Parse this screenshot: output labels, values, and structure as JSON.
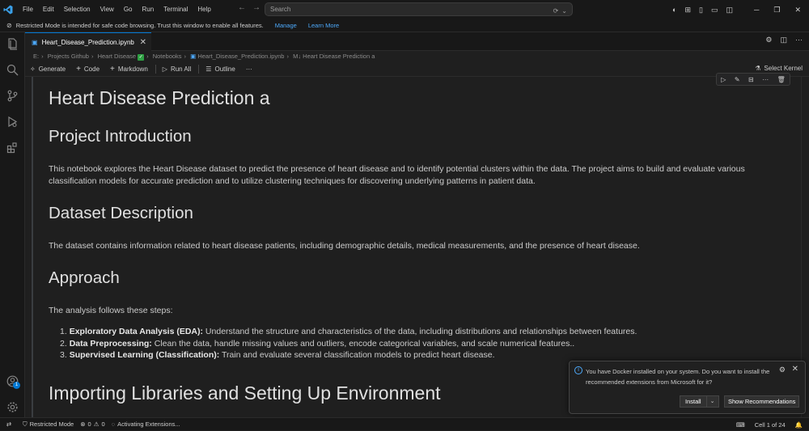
{
  "titlebar": {
    "menus": [
      "File",
      "Edit",
      "Selection",
      "View",
      "Go",
      "Run",
      "Terminal",
      "Help"
    ],
    "search_placeholder": "Search"
  },
  "restricted_banner": {
    "message": "Restricted Mode is intended for safe code browsing. Trust this window to enable all features.",
    "manage_label": "Manage",
    "learn_more_label": "Learn More"
  },
  "tab": {
    "filename": "Heart_Disease_Prediction.ipynb"
  },
  "breadcrumb": {
    "items": [
      "E:",
      "Projects Github",
      "Heart Disease",
      "Notebooks",
      "Heart_Disease_Prediction.ipynb",
      "Heart Disease Prediction a"
    ]
  },
  "toolbar": {
    "generate": "Generate",
    "code": "Code",
    "markdown": "Markdown",
    "run_all": "Run All",
    "outline": "Outline",
    "more": "···",
    "select_kernel": "Select Kernel"
  },
  "notebook": {
    "title": "Heart Disease Prediction a",
    "section1_heading": "Project Introduction",
    "section1_text": "This notebook explores the Heart Disease dataset to predict the presence of heart disease and to identify potential clusters within the data. The project aims to build and evaluate various classification models for accurate prediction and to utilize clustering techniques for discovering underlying patterns in patient data.",
    "section2_heading": "Dataset Description",
    "section2_text": "The dataset contains information related to heart disease patients, including demographic details, medical measurements, and the presence of heart disease.",
    "section3_heading": "Approach",
    "section3_intro": "The analysis follows these steps:",
    "steps": [
      {
        "num": "1.",
        "bold": "Exploratory Data Analysis (EDA):",
        "text": " Understand the structure and characteristics of the data, including distributions and relationships between features."
      },
      {
        "num": "2.",
        "bold": "Data Preprocessing:",
        "text": " Clean the data, handle missing values and outliers, encode categorical variables, and scale numerical features.."
      },
      {
        "num": "3.",
        "bold": "Supervised Learning (Classification):",
        "text": " Train and evaluate several classification models to predict heart disease."
      }
    ],
    "section4_heading": "Importing Libraries and Setting Up Environment"
  },
  "notification": {
    "message": "You have Docker installed on your system. Do you want to install the recommended extensions from Microsoft for it?",
    "install_label": "Install",
    "recommendations_label": "Show Recommendations"
  },
  "accounts_badge": "1",
  "statusbar": {
    "restricted": "Restricted Mode",
    "errors": "0",
    "warnings": "0",
    "activity": "Activating Extensions...",
    "cell_position": "Cell 1 of 24"
  }
}
